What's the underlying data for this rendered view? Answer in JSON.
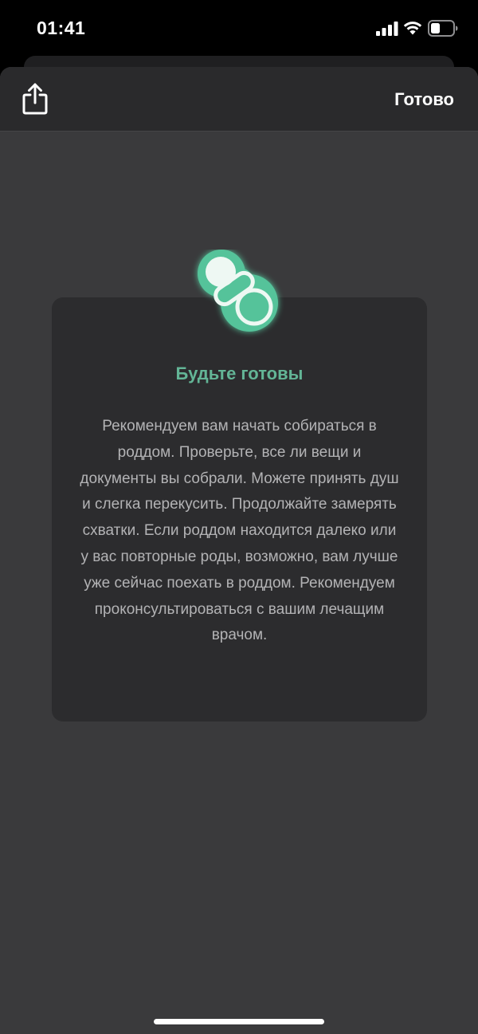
{
  "status_bar": {
    "time": "01:41"
  },
  "nav": {
    "share_icon": "share-icon",
    "done_label": "Готово"
  },
  "card": {
    "icon": "pacifier-icon",
    "title": "Будьте готовы",
    "text": "Рекомендуем вам начать собираться в роддом. Проверьте, все ли вещи и документы вы собрали. Можете принять душ и слегка перекусить. Продолжайте замерять схватки. Если роддом находится далеко или у вас повторные роды, возможно, вам лучше уже сейчас поехать в роддом. Рекомендуем проконсультироваться с вашим лечащим врачом."
  },
  "colors": {
    "accent": "#63b596",
    "background": "#3a3a3c",
    "card": "#2c2c2e"
  }
}
